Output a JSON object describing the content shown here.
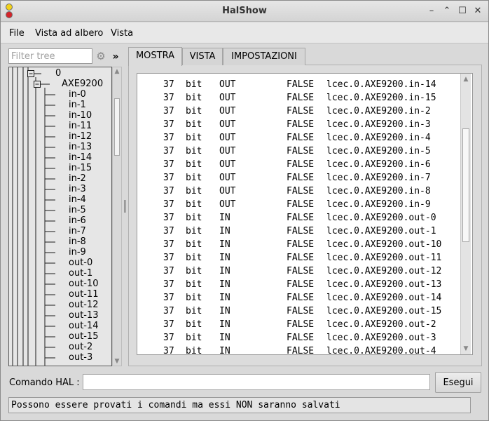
{
  "window": {
    "title": "HalShow"
  },
  "menu": [
    {
      "label": "File"
    },
    {
      "label": "Vista ad albero"
    },
    {
      "label": "Vista"
    }
  ],
  "filter": {
    "placeholder": "Filter tree",
    "value": "",
    "expand_label": "»"
  },
  "tree": {
    "root": "0",
    "device": "AXE9200",
    "items": [
      "in-0",
      "in-1",
      "in-10",
      "in-11",
      "in-12",
      "in-13",
      "in-14",
      "in-15",
      "in-2",
      "in-3",
      "in-4",
      "in-5",
      "in-6",
      "in-7",
      "in-8",
      "in-9",
      "out-0",
      "out-1",
      "out-10",
      "out-11",
      "out-12",
      "out-13",
      "out-14",
      "out-15",
      "out-2",
      "out-3"
    ]
  },
  "tabs": [
    {
      "label": "MOSTRA",
      "active": true
    },
    {
      "label": "VISTA",
      "active": false
    },
    {
      "label": "IMPOSTAZIONI",
      "active": false
    }
  ],
  "pins": [
    {
      "owner": "37",
      "type": "bit",
      "dir": "OUT",
      "value": "FALSE",
      "name": "lcec.0.AXE9200.in-14"
    },
    {
      "owner": "37",
      "type": "bit",
      "dir": "OUT",
      "value": "FALSE",
      "name": "lcec.0.AXE9200.in-15"
    },
    {
      "owner": "37",
      "type": "bit",
      "dir": "OUT",
      "value": "FALSE",
      "name": "lcec.0.AXE9200.in-2"
    },
    {
      "owner": "37",
      "type": "bit",
      "dir": "OUT",
      "value": "FALSE",
      "name": "lcec.0.AXE9200.in-3"
    },
    {
      "owner": "37",
      "type": "bit",
      "dir": "OUT",
      "value": "FALSE",
      "name": "lcec.0.AXE9200.in-4"
    },
    {
      "owner": "37",
      "type": "bit",
      "dir": "OUT",
      "value": "FALSE",
      "name": "lcec.0.AXE9200.in-5"
    },
    {
      "owner": "37",
      "type": "bit",
      "dir": "OUT",
      "value": "FALSE",
      "name": "lcec.0.AXE9200.in-6"
    },
    {
      "owner": "37",
      "type": "bit",
      "dir": "OUT",
      "value": "FALSE",
      "name": "lcec.0.AXE9200.in-7"
    },
    {
      "owner": "37",
      "type": "bit",
      "dir": "OUT",
      "value": "FALSE",
      "name": "lcec.0.AXE9200.in-8"
    },
    {
      "owner": "37",
      "type": "bit",
      "dir": "OUT",
      "value": "FALSE",
      "name": "lcec.0.AXE9200.in-9"
    },
    {
      "owner": "37",
      "type": "bit",
      "dir": "IN",
      "value": "FALSE",
      "name": "lcec.0.AXE9200.out-0"
    },
    {
      "owner": "37",
      "type": "bit",
      "dir": "IN",
      "value": "FALSE",
      "name": "lcec.0.AXE9200.out-1"
    },
    {
      "owner": "37",
      "type": "bit",
      "dir": "IN",
      "value": "FALSE",
      "name": "lcec.0.AXE9200.out-10"
    },
    {
      "owner": "37",
      "type": "bit",
      "dir": "IN",
      "value": "FALSE",
      "name": "lcec.0.AXE9200.out-11"
    },
    {
      "owner": "37",
      "type": "bit",
      "dir": "IN",
      "value": "FALSE",
      "name": "lcec.0.AXE9200.out-12"
    },
    {
      "owner": "37",
      "type": "bit",
      "dir": "IN",
      "value": "FALSE",
      "name": "lcec.0.AXE9200.out-13"
    },
    {
      "owner": "37",
      "type": "bit",
      "dir": "IN",
      "value": "FALSE",
      "name": "lcec.0.AXE9200.out-14"
    },
    {
      "owner": "37",
      "type": "bit",
      "dir": "IN",
      "value": "FALSE",
      "name": "lcec.0.AXE9200.out-15"
    },
    {
      "owner": "37",
      "type": "bit",
      "dir": "IN",
      "value": "FALSE",
      "name": "lcec.0.AXE9200.out-2"
    },
    {
      "owner": "37",
      "type": "bit",
      "dir": "IN",
      "value": "FALSE",
      "name": "lcec.0.AXE9200.out-3"
    },
    {
      "owner": "37",
      "type": "bit",
      "dir": "IN",
      "value": "FALSE",
      "name": "lcec.0.AXE9200.out-4"
    }
  ],
  "command": {
    "label": "Comando HAL :",
    "value": "",
    "button": "Esegui"
  },
  "status": "Possono essere provati i comandi ma essi NON saranno salvati"
}
